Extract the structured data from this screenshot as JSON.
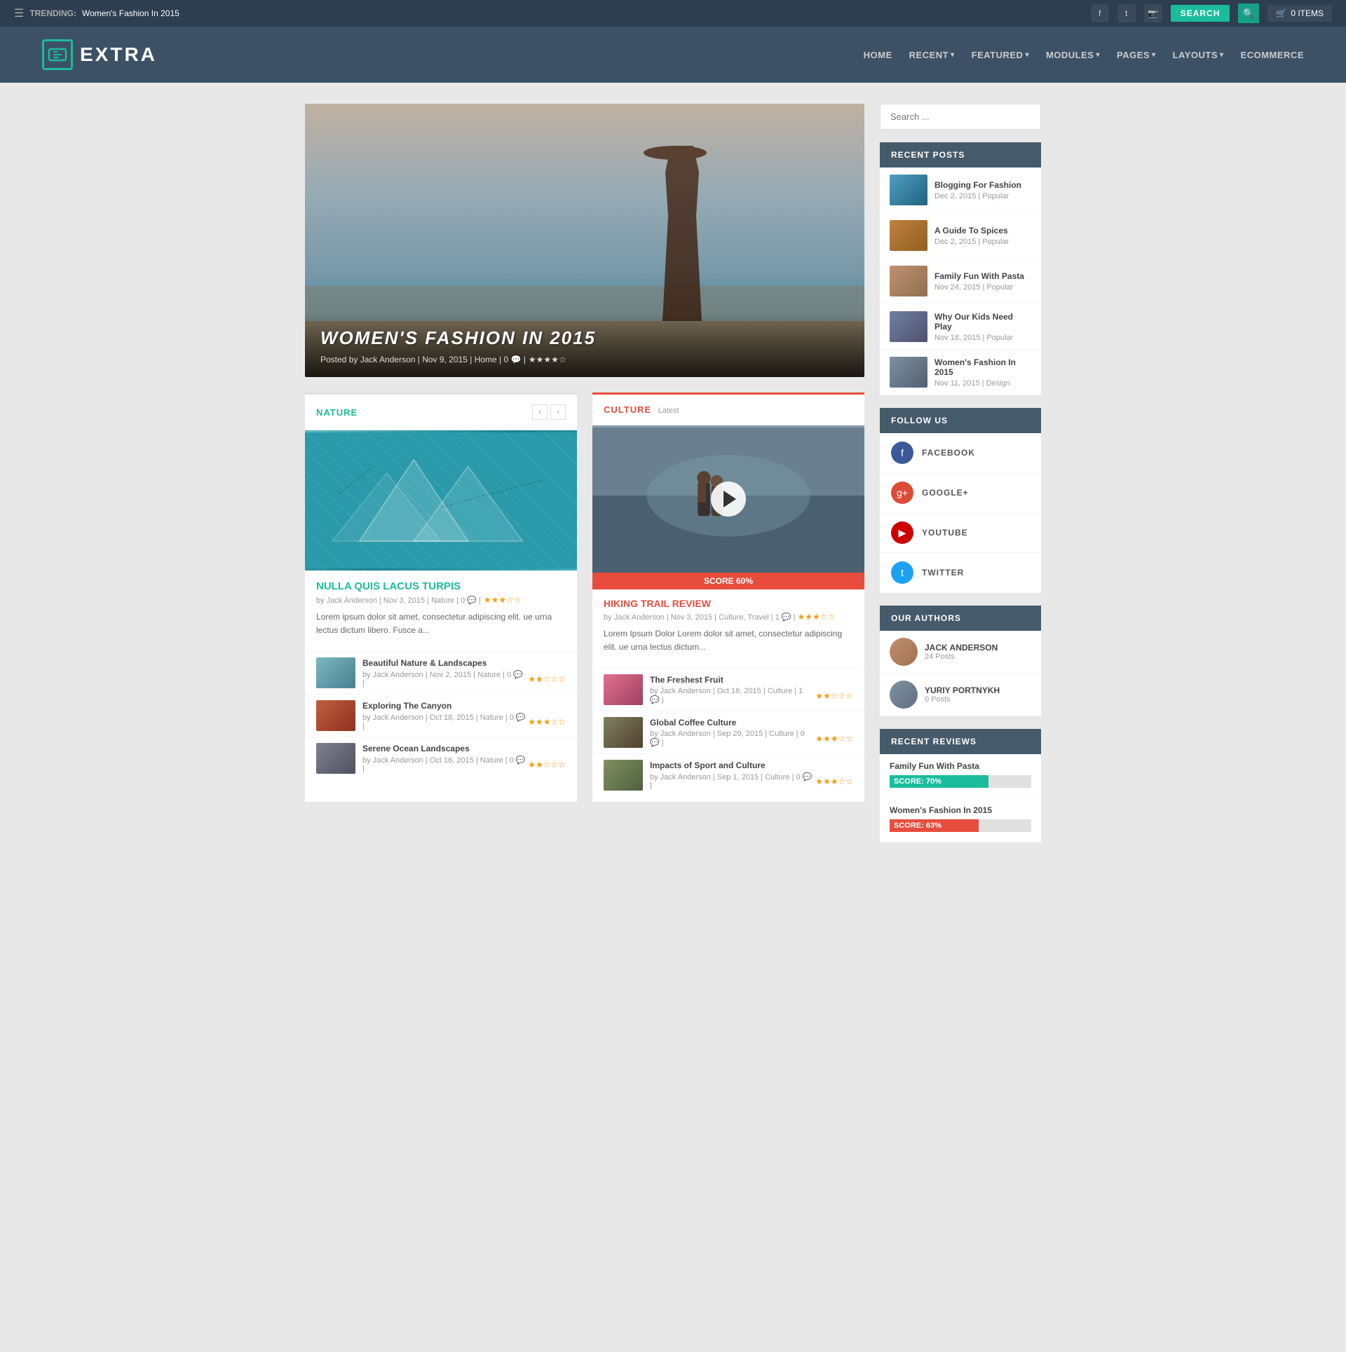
{
  "topbar": {
    "trending_label": "TRENDING:",
    "trending_value": "Women's Fashion In 2015",
    "search_label": "SEARCH",
    "cart_label": "0 ITEMS"
  },
  "header": {
    "logo_text": "EXTRA",
    "nav": [
      {
        "label": "HOME",
        "has_arrow": false
      },
      {
        "label": "RECENT",
        "has_arrow": true
      },
      {
        "label": "FEATURED",
        "has_arrow": true
      },
      {
        "label": "MODULES",
        "has_arrow": true
      },
      {
        "label": "PAGES",
        "has_arrow": true
      },
      {
        "label": "LAYOUTS",
        "has_arrow": true
      },
      {
        "label": "ECOMMERCE",
        "has_arrow": false
      }
    ]
  },
  "hero": {
    "title": "WOMEN'S FASHION IN 2015",
    "meta": "Posted by Jack Anderson | Nov 9, 2015 | Home | 0 💬 |"
  },
  "nature": {
    "section_title": "NATURE",
    "main_post": {
      "title": "NULLA QUIS LACUS TURPIS",
      "meta": "by Jack Anderson | Nov 3, 2015 | Nature | 0 💬 |",
      "excerpt": "Lorem ipsum dolor sit amet, consectetur adipiscing elit. ue urna lectus dictum libero. Fusce a..."
    },
    "posts": [
      {
        "title": "Beautiful Nature & Landscapes",
        "meta": "by Jack Anderson | Nov 2, 2015 | Nature | 0 💬 |",
        "thumb": "nature1"
      },
      {
        "title": "Exploring The Canyon",
        "meta": "by Jack Anderson | Oct 18, 2015 | Nature | 0 💬 |",
        "thumb": "nature2"
      },
      {
        "title": "Serene Ocean Landscapes",
        "meta": "by Jack Anderson | Oct 16, 2015 | Nature | 0 💬 |",
        "thumb": "nature3"
      }
    ]
  },
  "culture": {
    "section_title": "CULTURE",
    "badge": "Latest",
    "video_score": "SCORE 60%",
    "main_post": {
      "title": "HIKING TRAIL REVIEW",
      "meta": "by Jack Anderson | Nov 3, 2015 | Culture, Travel | 1 💬 |",
      "excerpt": "Lorem Ipsum Dolor Lorem dolor sit amet, consectetur adipiscing elit. ue urna lectus dictum..."
    },
    "posts": [
      {
        "title": "The Freshest Fruit",
        "meta": "by Jack Anderson | Oct 18, 2015 | Culture | 1 💬 |",
        "thumb": "culture1"
      },
      {
        "title": "Global Coffee Culture",
        "meta": "by Jack Anderson | Sep 20, 2015 | Culture | 0 💬 |",
        "thumb": "culture2"
      },
      {
        "title": "Impacts of Sport and Culture",
        "meta": "by Jack Anderson | Sep 1, 2015 | Culture | 0 💬 |",
        "thumb": "culture3"
      }
    ]
  },
  "sidebar": {
    "search_placeholder": "Search ...",
    "recent_posts_title": "RECENT POSTS",
    "recent_posts": [
      {
        "title": "Blogging For Fashion",
        "meta": "Dec 2, 2015 | Popular",
        "thumb": "rt1"
      },
      {
        "title": "A Guide To Spices",
        "meta": "Dec 2, 2015 | Popular",
        "thumb": "rt2"
      },
      {
        "title": "Family Fun With Pasta",
        "meta": "Nov 24, 2015 | Popular",
        "thumb": "rt3"
      },
      {
        "title": "Why Our Kids Need Play",
        "meta": "Nov 18, 2015 | Popular",
        "thumb": "rt4"
      },
      {
        "title": "Women's Fashion In 2015",
        "meta": "Nov 11, 2015 | Design",
        "thumb": "rt5"
      }
    ],
    "follow_title": "FOLLOW US",
    "follow_items": [
      {
        "label": "FACEBOOK",
        "icon": "f",
        "class": "fi-fb"
      },
      {
        "label": "GOOGLE+",
        "icon": "g+",
        "class": "fi-gp"
      },
      {
        "label": "YOUTUBE",
        "icon": "▶",
        "class": "fi-yt"
      },
      {
        "label": "TWITTER",
        "icon": "t",
        "class": "fi-tw"
      }
    ],
    "authors_title": "OUR AUTHORS",
    "authors": [
      {
        "name": "JACK ANDERSON",
        "posts": "24 Posts",
        "avatar": "av1"
      },
      {
        "name": "YURIY PORTNYKH",
        "posts": "0 Posts",
        "avatar": "av2"
      }
    ],
    "reviews_title": "RECENT REVIEWS",
    "reviews": [
      {
        "title": "Family Fun With Pasta",
        "score": 70,
        "score_label": "SCORE: 70%",
        "fill_class": "score-fill-teal"
      },
      {
        "title": "Women's Fashion In 2015",
        "score": 63,
        "score_label": "SCORE: 63%",
        "fill_class": "score-fill-pink"
      }
    ]
  }
}
